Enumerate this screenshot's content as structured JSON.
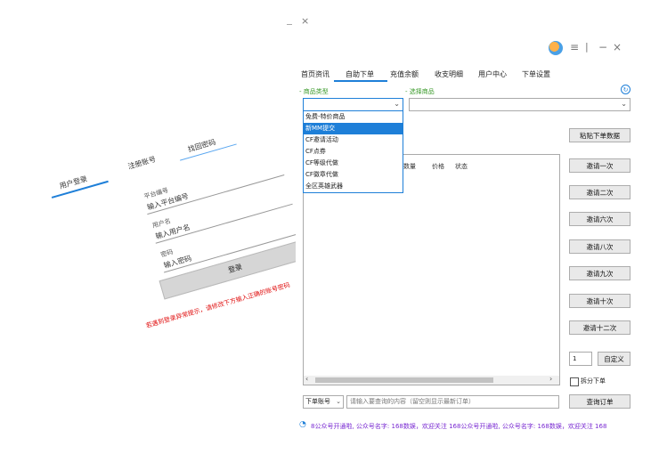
{
  "background": {
    "stray_close": "×",
    "login_panel": {
      "tabs": [
        "用户登录",
        "注册账号",
        "找回密码"
      ],
      "server_label": "平台编号",
      "server_placeholder": "输入平台编号",
      "user_label": "用户名",
      "user_placeholder": "输入用户名",
      "password_label": "密码",
      "password_placeholder": "输入密码",
      "login_button": "登录",
      "warning": "若遇到登录异常提示，请修改下方输入正确的账号密码"
    }
  },
  "window": {
    "icon": "avatar-icon",
    "menu_icon": "≡",
    "separator": "|",
    "minimize": "−",
    "close": "×"
  },
  "tabs": [
    {
      "label": "首页资讯"
    },
    {
      "label": "自助下单",
      "active": true
    },
    {
      "label": "充值余额"
    },
    {
      "label": "收支明细"
    },
    {
      "label": "用户中心"
    },
    {
      "label": "下单设置"
    }
  ],
  "accent_color": "#1e7fd8",
  "product_type": {
    "label": "- 商品类型",
    "value": "",
    "options": [
      "免费-特价商品",
      "新MM提交",
      "CF邀请活动",
      "CF点券",
      "CF等级代做",
      "CF徽章代做",
      "全区英雄武器"
    ],
    "selected_index": 1
  },
  "product": {
    "label": "- 选择商品",
    "value": ""
  },
  "table": {
    "columns": [
      "数量",
      "价格",
      "状态"
    ],
    "rows": []
  },
  "buttons": {
    "paste": "粘贴下单数据",
    "invite": [
      "邀请一次",
      "邀请二次",
      "邀请六次",
      "邀请八次",
      "邀请九次",
      "邀请十次",
      "邀请十二次"
    ],
    "custom": "自定义",
    "query": "查询订单"
  },
  "quantity": "1",
  "split_label": "拆分下单",
  "account_combo": "下单账号",
  "query_placeholder": "请输入要查询的内容（留空则显示最新订单）",
  "ticker": "8公众号开通啦, 公众号名字: 168数娱，欢迎关注     168公众号开通啦, 公众号名字: 168数娱，欢迎关注     168"
}
